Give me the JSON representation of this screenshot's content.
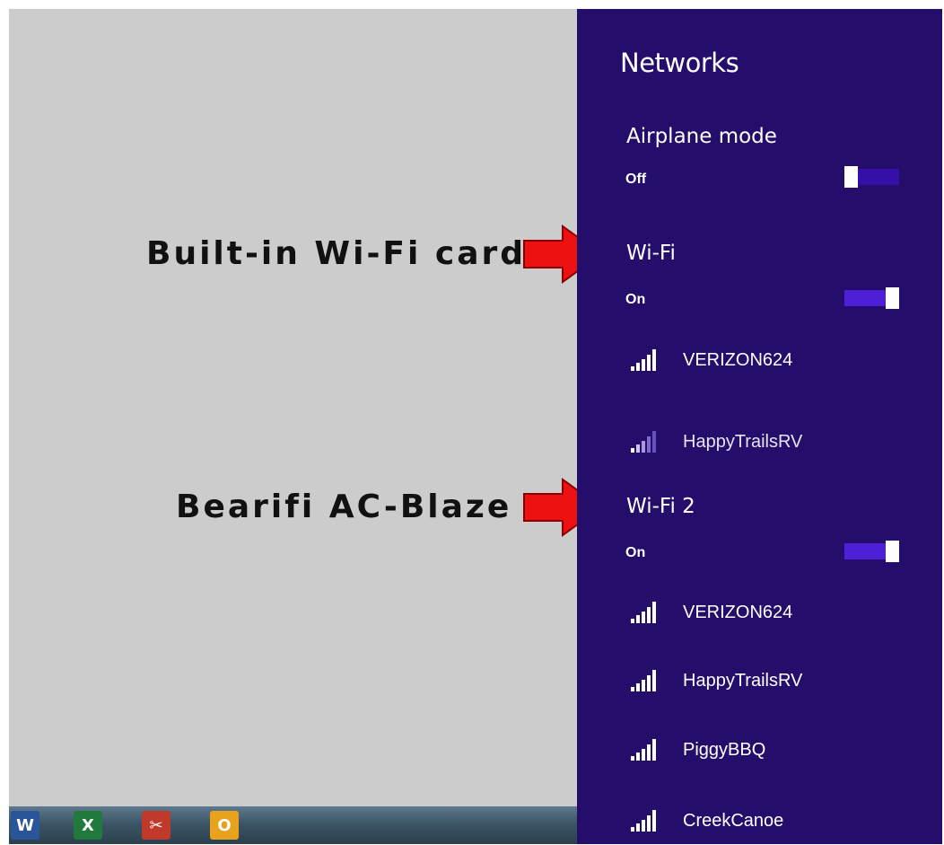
{
  "annotations": {
    "builtin": "Built-in Wi-Fi card",
    "bearifi": "Bearifi AC-Blaze"
  },
  "panel": {
    "title": "Networks",
    "airplane": {
      "label": "Airplane mode",
      "state": "Off",
      "enabled": false
    },
    "wifi": {
      "label": "Wi-Fi",
      "state": "On",
      "enabled": true,
      "networks": [
        {
          "name": "VERIZON624",
          "signal_bars": 5,
          "strong": true
        },
        {
          "name": "HappyTrailsRV",
          "signal_bars": 5,
          "strong": false
        }
      ]
    },
    "wifi2": {
      "label": "Wi-Fi 2",
      "state": "On",
      "enabled": true,
      "networks": [
        {
          "name": "VERIZON624",
          "signal_bars": 5,
          "strong": true
        },
        {
          "name": "HappyTrailsRV",
          "signal_bars": 5,
          "strong": true
        },
        {
          "name": "PiggyBBQ",
          "signal_bars": 5,
          "strong": true
        },
        {
          "name": "CreekCanoe",
          "signal_bars": 5,
          "strong": true
        }
      ]
    }
  },
  "taskbar": {
    "apps": [
      {
        "icon": "word-icon",
        "glyph": "W",
        "color": "#2a5699"
      },
      {
        "icon": "excel-icon",
        "glyph": "X",
        "color": "#1f7a3c"
      },
      {
        "icon": "snipping-tool-icon",
        "glyph": "✂",
        "color": "#c0392b"
      },
      {
        "icon": "outlook-icon",
        "glyph": "O",
        "color": "#e8a21c"
      }
    ]
  },
  "colors": {
    "panel_bg": "#250e6b",
    "desktop_bg": "#cccccc",
    "arrow_red": "#ee1111",
    "toggle_on": "#4d1fd6"
  }
}
